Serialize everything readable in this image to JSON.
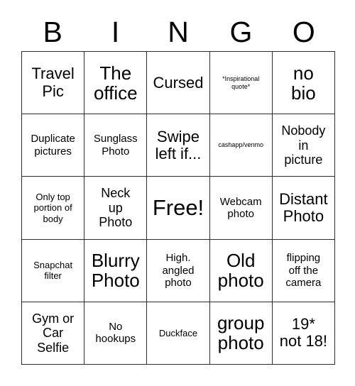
{
  "card": {
    "title": "BINGO",
    "header_letters": [
      "B",
      "I",
      "N",
      "G",
      "O"
    ],
    "grid_size": "5x5",
    "border_color": "#2b2b2b",
    "background_color": "#ffffff",
    "text_color": "#000000",
    "free_space": "Free!",
    "rows": [
      [
        {
          "text": "Travel\nPic",
          "size": "xl"
        },
        {
          "text": "The\noffice",
          "size": "2xl"
        },
        {
          "text": "Cursed",
          "size": "xl"
        },
        {
          "text": "*Inspirational\nquote*",
          "size": "xs"
        },
        {
          "text": "no\nbio",
          "size": "2xl"
        }
      ],
      [
        {
          "text": "Duplicate\npictures",
          "size": "md"
        },
        {
          "text": "Sunglass\nPhoto",
          "size": "md"
        },
        {
          "text": "Swipe\nleft if...",
          "size": "xl"
        },
        {
          "text": "cashapp/venmo",
          "size": "xs"
        },
        {
          "text": "Nobody\nin\npicture",
          "size": "lg"
        }
      ],
      [
        {
          "text": "Only top\nportion of\nbody",
          "size": "sm"
        },
        {
          "text": "Neck\nup\nPhoto",
          "size": "lg"
        },
        {
          "text": "Free!",
          "size": "3xl"
        },
        {
          "text": "Webcam\nphoto",
          "size": "md"
        },
        {
          "text": "Distant\nPhoto",
          "size": "xl"
        }
      ],
      [
        {
          "text": "Snapchat\nfilter",
          "size": "sm"
        },
        {
          "text": "Blurry\nPhoto",
          "size": "2xl"
        },
        {
          "text": "High.\nangled\nphoto",
          "size": "md"
        },
        {
          "text": "Old\nphoto",
          "size": "2xl"
        },
        {
          "text": "flipping\noff the\ncamera",
          "size": "md"
        }
      ],
      [
        {
          "text": "Gym or\nCar\nSelfie",
          "size": "lg"
        },
        {
          "text": "No\nhookups",
          "size": "md"
        },
        {
          "text": "Duckface",
          "size": "sm"
        },
        {
          "text": "group\nphoto",
          "size": "2xl"
        },
        {
          "text": "19*\nnot 18!",
          "size": "xl"
        }
      ]
    ]
  }
}
